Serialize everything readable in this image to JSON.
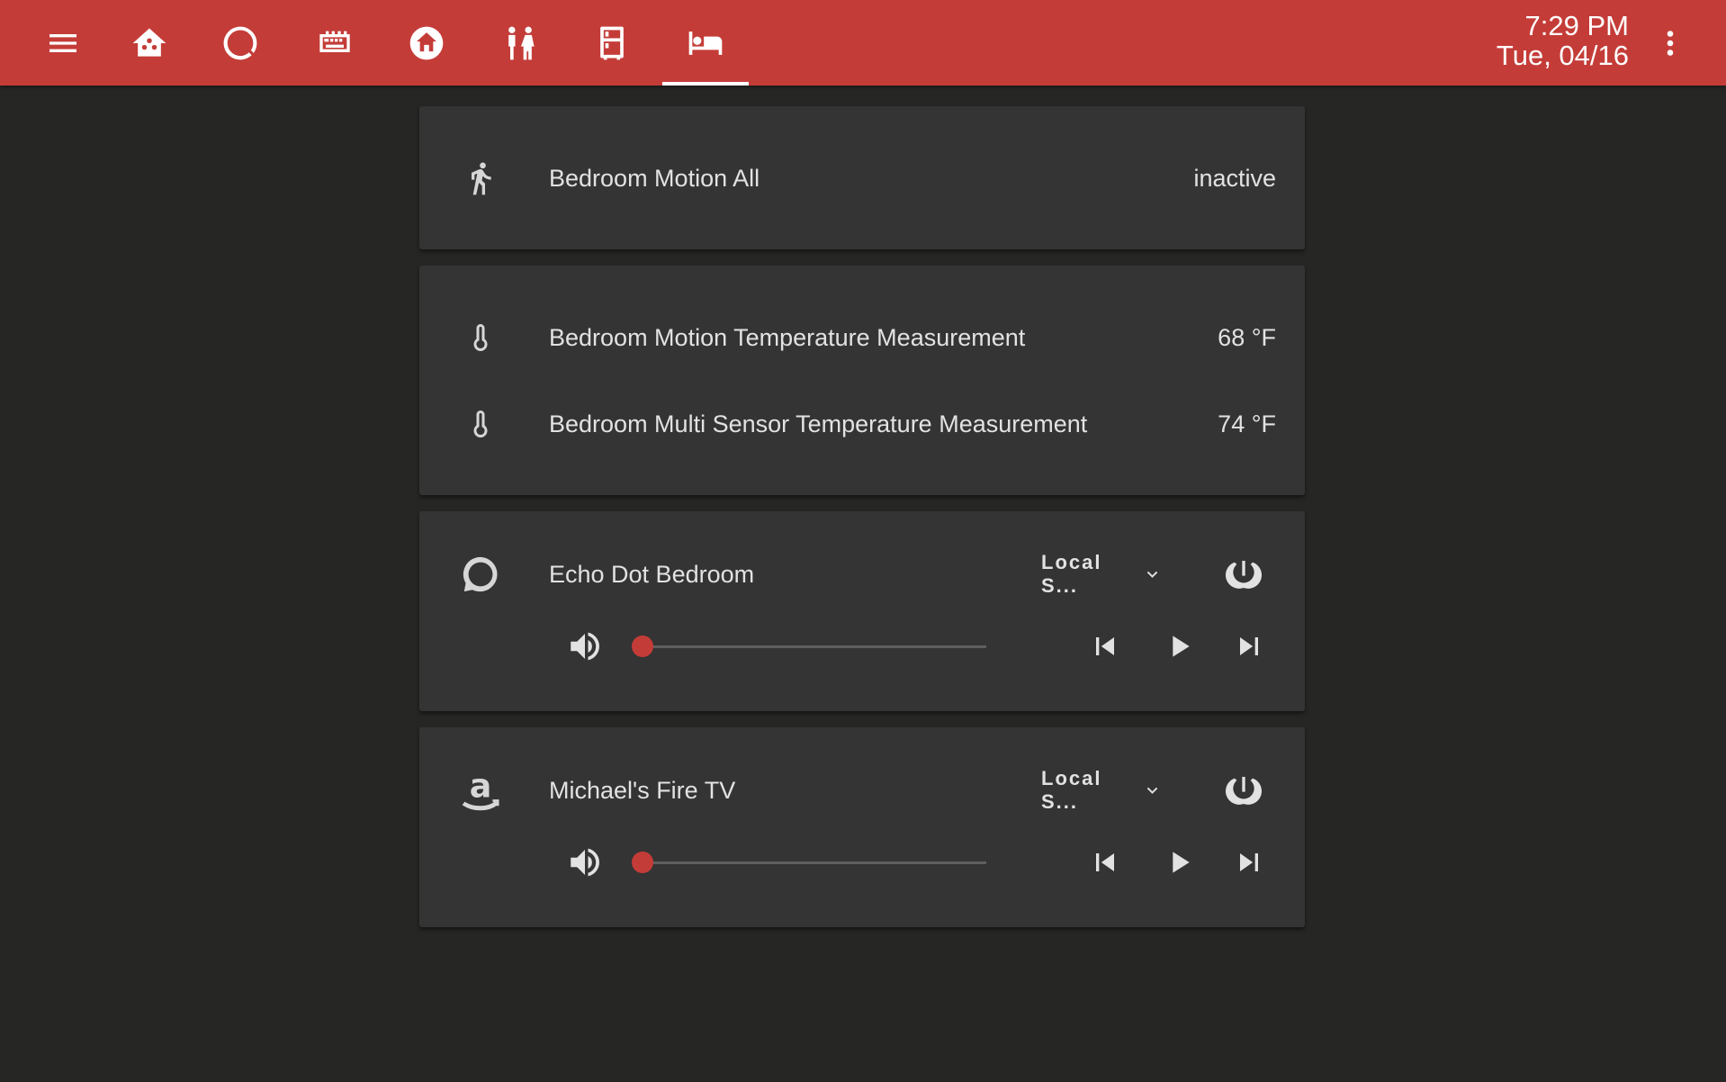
{
  "topbar": {
    "menu_icon": "menu-icon",
    "tabs": [
      {
        "icon": "home-automation-icon",
        "active": false
      },
      {
        "icon": "alexa-ring-icon",
        "active": false
      },
      {
        "icon": "router-icon",
        "active": false
      },
      {
        "icon": "home-circle-icon",
        "active": false
      },
      {
        "icon": "kids-icon",
        "active": false
      },
      {
        "icon": "fridge-icon",
        "active": false
      },
      {
        "icon": "bed-icon",
        "active": true
      }
    ],
    "time": "7:29 PM",
    "date": "Tue, 04/16",
    "overflow_icon": "dots-vertical-icon"
  },
  "motion_card": {
    "icon": "walk-icon",
    "name": "Bedroom Motion All",
    "state": "inactive"
  },
  "temperature_card": {
    "rows": [
      {
        "icon": "thermometer-icon",
        "name": "Bedroom Motion Temperature Measurement",
        "state": "68 °F"
      },
      {
        "icon": "thermometer-icon",
        "name": "Bedroom Multi Sensor Temperature Measurement",
        "state": "74 °F"
      }
    ]
  },
  "media_players": [
    {
      "icon": "alexa-ring-icon",
      "name": "Echo Dot Bedroom",
      "source": "Local S...",
      "volume_fraction": 0.0
    },
    {
      "icon": "amazon-icon",
      "name": "Michael's Fire TV",
      "source": "Local S...",
      "volume_fraction": 0.0
    }
  ],
  "colors": {
    "accent": "#c43c38",
    "background": "#262724",
    "card": "#343434",
    "text": "#e2e2e2"
  }
}
